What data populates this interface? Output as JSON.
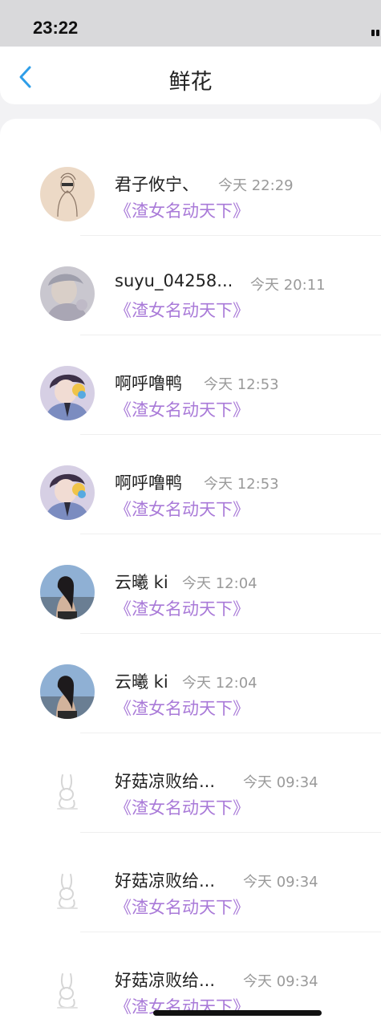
{
  "status_bar": {
    "time": "23:22"
  },
  "header": {
    "title": "鲜花",
    "back_icon": "chevron-left-icon",
    "accent": "#2f9ee8"
  },
  "colors": {
    "book_title": "#a97ad8",
    "timestamp": "#9a9a9a"
  },
  "items": [
    {
      "name": "君子攸宁、",
      "time": "今天 22:29",
      "book": "《渣女名动天下》",
      "avatar": "sketch-avatar"
    },
    {
      "name": "suyu_04258...",
      "time": "今天 20:11",
      "book": "《渣女名动天下》",
      "avatar": "faded-anime-avatar"
    },
    {
      "name": "啊呼噜鸭",
      "time": "今天 12:53",
      "book": "《渣女名动天下》",
      "avatar": "anime-boy-avatar"
    },
    {
      "name": "啊呼噜鸭",
      "time": "今天 12:53",
      "book": "《渣女名动天下》",
      "avatar": "anime-boy-avatar"
    },
    {
      "name": "云曦 ki",
      "time": "今天 12:04",
      "book": "《渣女名动天下》",
      "avatar": "photo-girl-avatar"
    },
    {
      "name": "云曦 ki",
      "time": "今天 12:04",
      "book": "《渣女名动天下》",
      "avatar": "photo-girl-avatar"
    },
    {
      "name": "好菇凉败给...",
      "time": "今天 09:34",
      "book": "《渣女名动天下》",
      "avatar": "rabbit-avatar"
    },
    {
      "name": "好菇凉败给...",
      "time": "今天 09:34",
      "book": "《渣女名动天下》",
      "avatar": "rabbit-avatar"
    },
    {
      "name": "好菇凉败给...",
      "time": "今天 09:34",
      "book": "《渣女名动天下》",
      "avatar": "rabbit-avatar"
    }
  ]
}
